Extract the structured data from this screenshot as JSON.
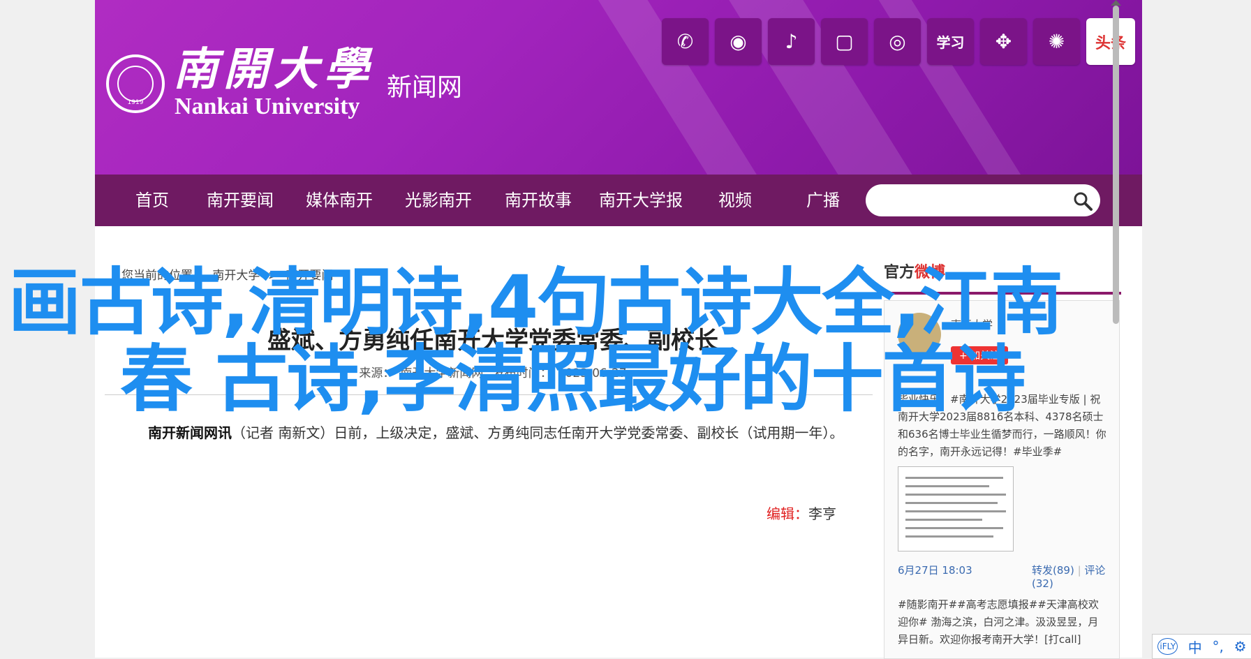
{
  "site": {
    "name_cn": "南開大學",
    "name_en": "Nankai University",
    "site_label": "新闻网",
    "seal_year": "1919"
  },
  "social": [
    {
      "name": "wechat-icon",
      "glyph": "✆"
    },
    {
      "name": "weibo-icon",
      "glyph": "◉"
    },
    {
      "name": "douyin-icon",
      "glyph": "♪"
    },
    {
      "name": "bilibili-icon",
      "glyph": "▢"
    },
    {
      "name": "kuaishou-icon",
      "glyph": "◎"
    },
    {
      "name": "xuexi-icon",
      "glyph": "学习"
    },
    {
      "name": "app-icon",
      "glyph": "✥"
    },
    {
      "name": "dandelion-icon",
      "glyph": "✺"
    },
    {
      "name": "toutiao-icon",
      "glyph": "头条"
    }
  ],
  "nav": [
    "首页",
    "南开要闻",
    "媒体南开",
    "光影南开",
    "南开故事",
    "南开大学报",
    "视频",
    "广播"
  ],
  "search": {
    "placeholder": ""
  },
  "breadcrumb": [
    "您当前的位置：",
    "南开大学",
    ">",
    "南开要闻"
  ],
  "article": {
    "title": "盛斌、方勇纯任南开大学党委常委、副校长",
    "source_label": "来源：",
    "source": "南开大学新闻网",
    "date_label": "发布时间：",
    "date": "2023-06-27",
    "body_lead": "南开新闻网讯",
    "body": "（记者 南新文）日前，上级决定，盛斌、方勇纯同志任南开大学党委常委、副校长（试用期一年）。",
    "editor_label": "编辑：",
    "editor": "李亨"
  },
  "sidebar": {
    "head_prefix": "官方",
    "head_weibo": "微博",
    "account": "南开大学",
    "follow": "+ 加关注",
    "post1": "毕业快乐！#南开大学2023届毕业专版 | 祝南开大学2023届8816名本科、4378名硕士和636名博士毕业生循梦而行，一路顺风！你的名字，南开永远记得！#毕业季#",
    "post_date": "6月27日 18:03",
    "repost": "转发(89)",
    "comment": "评论(32)",
    "post2": "#随影南开##高考志愿填报##天津高校欢迎你# 渤海之滨，白河之津。汲汲昱昱，月异日新。欢迎你报考南开大学！[打call]"
  },
  "overlay": {
    "line1": "画古诗,清明诗,4句古诗大全,江南",
    "line2": "春 古诗,李清照最好的十首诗"
  },
  "ime": {
    "brand": "iFLY",
    "mode": "中",
    "punct": "°,",
    "settings": "⚙"
  },
  "colors": {
    "banner": "#a224bd",
    "nav": "#6f1a62",
    "overlay_text": "#1e8ef0",
    "weibo_red": "#dd3333"
  }
}
